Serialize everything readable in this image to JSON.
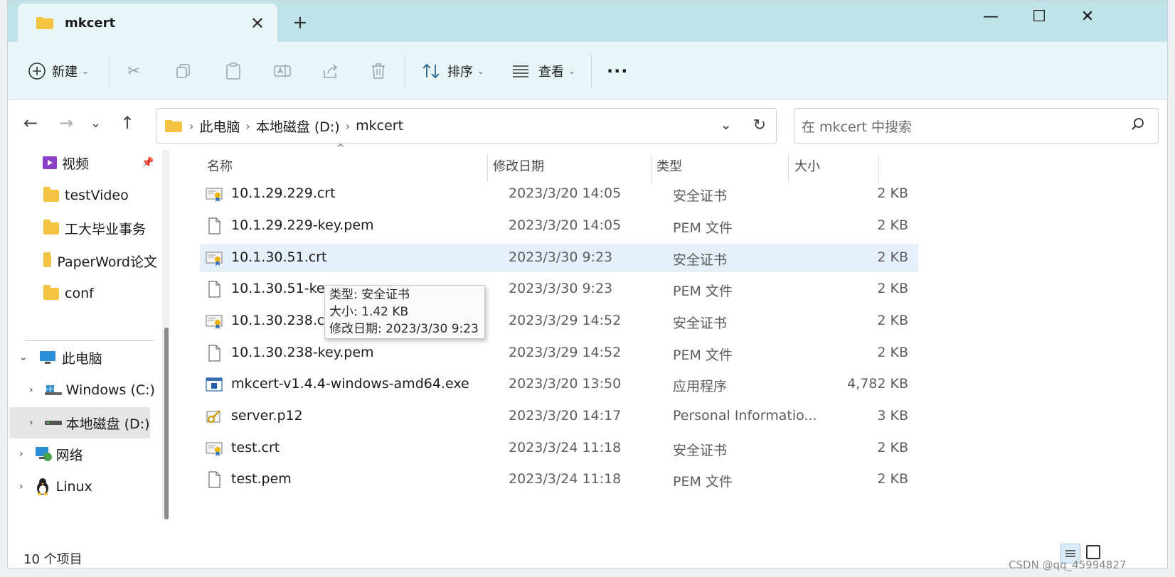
{
  "window": {
    "tab_title": "mkcert",
    "close_tab": "✕",
    "new_tab": "+",
    "minimize": "—",
    "maximize": "☐",
    "close": "✕"
  },
  "toolbar": {
    "new_label": "新建",
    "sort_label": "排序",
    "view_label": "查看",
    "more_label": "···"
  },
  "nav": {
    "breadcrumb": [
      "此电脑",
      "本地磁盘 (D:)",
      "mkcert"
    ],
    "search_placeholder": "在 mkcert 中搜索"
  },
  "sidebar": {
    "quick": [
      {
        "label": "视频"
      },
      {
        "label": "testVideo"
      },
      {
        "label": "工大毕业事务"
      },
      {
        "label": "PaperWord论文"
      },
      {
        "label": "conf"
      }
    ],
    "tree": [
      {
        "label": "此电脑"
      },
      {
        "label": "Windows (C:)"
      },
      {
        "label": "本地磁盘 (D:)"
      },
      {
        "label": "网络"
      },
      {
        "label": "Linux"
      }
    ]
  },
  "columns": {
    "name": "名称",
    "date": "修改日期",
    "type": "类型",
    "size": "大小"
  },
  "files": [
    {
      "name": "10.1.29.229.crt",
      "date": "2023/3/20 14:05",
      "type": "安全证书",
      "size": "2 KB",
      "icon": "certificate-icon"
    },
    {
      "name": "10.1.29.229-key.pem",
      "date": "2023/3/20 14:05",
      "type": "PEM 文件",
      "size": "2 KB",
      "icon": "file-icon"
    },
    {
      "name": "10.1.30.51.crt",
      "date": "2023/3/30 9:23",
      "type": "安全证书",
      "size": "2 KB",
      "icon": "certificate-icon"
    },
    {
      "name": "10.1.30.51-key.pem",
      "date": "2023/3/30 9:23",
      "type": "PEM 文件",
      "size": "2 KB",
      "icon": "file-icon"
    },
    {
      "name": "10.1.30.238.crt",
      "date": "2023/3/29 14:52",
      "type": "安全证书",
      "size": "2 KB",
      "icon": "certificate-icon"
    },
    {
      "name": "10.1.30.238-key.pem",
      "date": "2023/3/29 14:52",
      "type": "PEM 文件",
      "size": "2 KB",
      "icon": "file-icon"
    },
    {
      "name": "mkcert-v1.4.4-windows-amd64.exe",
      "date": "2023/3/20 13:50",
      "type": "应用程序",
      "size": "4,782 KB",
      "icon": "exe-icon"
    },
    {
      "name": "server.p12",
      "date": "2023/3/20 14:17",
      "type": "Personal Informatio...",
      "size": "3 KB",
      "icon": "pfx-icon"
    },
    {
      "name": "test.crt",
      "date": "2023/3/24 11:18",
      "type": "安全证书",
      "size": "2 KB",
      "icon": "certificate-icon"
    },
    {
      "name": "test.pem",
      "date": "2023/3/24 11:18",
      "type": "PEM 文件",
      "size": "2 KB",
      "icon": "file-icon"
    }
  ],
  "tooltip": {
    "line1": "类型: 安全证书",
    "line2": "大小: 1.42 KB",
    "line3": "修改日期: 2023/3/30 9:23"
  },
  "status": {
    "count": "10 个项目"
  },
  "watermark": "CSDN @qq_45994827",
  "colors": {
    "accent": "#0067c0",
    "tab_strip": "#bfe3e8",
    "toolbar": "#e9f6f8",
    "selection": "#e6f0fa"
  }
}
